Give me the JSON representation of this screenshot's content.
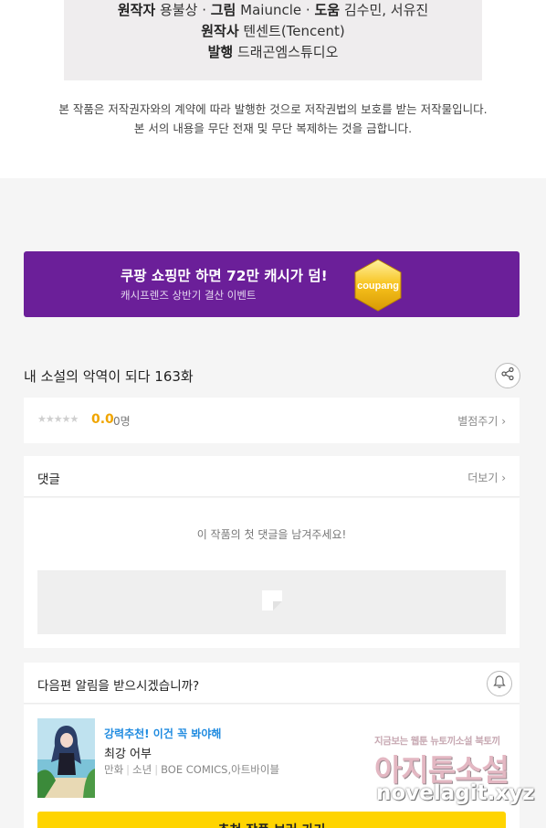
{
  "credits": {
    "line1": [
      {
        "role": "원작자",
        "name": "용불상"
      },
      {
        "role": "그림",
        "name": "Maiuncle"
      },
      {
        "role": "도움",
        "name": "김수민, 서유진"
      }
    ],
    "line2": {
      "role": "원작사",
      "name": "텐센트(Tencent)"
    },
    "line3": {
      "role": "발행",
      "name": "드래곤엠스튜디오"
    },
    "separator": "·"
  },
  "notice": {
    "line1": "본 작품은 저작권자와의 계약에 따라 발행한 것으로 저작권법의 보호를 받는 저작물입니다.",
    "line2": "본 서의 내용을 무단 전재 및 무단 복제하는 것을 금합니다."
  },
  "banner": {
    "title": "쿠팡 쇼핑만 하면 72만 캐시가 덤!",
    "subtitle": "캐시프렌즈 상반기 결산 이벤트",
    "badge_text": "coupang",
    "color": "#6b1f99"
  },
  "episode": {
    "title": "내 소설의 악역이 되다 163화",
    "share_icon": "share-icon"
  },
  "rating": {
    "stars": "★★★★★",
    "score": "0.0",
    "count": "0명",
    "rate_link": "별점주기 ›"
  },
  "comments": {
    "label": "댓글",
    "more": "더보기 ›",
    "empty_message": "이 작품의 첫 댓글을 남겨주세요!"
  },
  "notify": {
    "question": "다음편 알림을 받으시겠습니까?",
    "bell_icon": "bell-icon"
  },
  "recommend": {
    "tag": "강력추천! 이건 꼭 봐야해",
    "title": "최강 어부",
    "meta": [
      "만화",
      "소년",
      "BOE COMICS,아트바이블"
    ],
    "button": "추천 작품 보러 가기"
  },
  "watermark": {
    "top": "지금보는 웹툰 뉴토끼소설 북토끼",
    "main": "아지툰소설",
    "url": "novelagit.xyz"
  }
}
